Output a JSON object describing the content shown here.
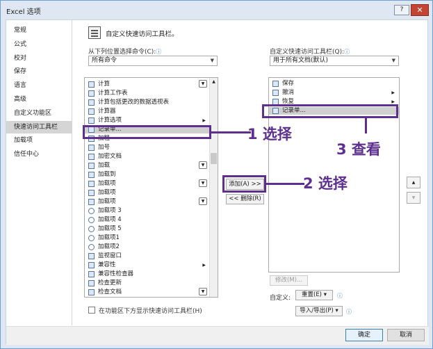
{
  "window": {
    "title": "Excel 选项",
    "help": "?",
    "close": "✕"
  },
  "nav": [
    "常规",
    "公式",
    "校对",
    "保存",
    "语言",
    "高级",
    "自定义功能区",
    "快速访问工具栏",
    "加载项",
    "信任中心"
  ],
  "nav_selected": 7,
  "header": {
    "title": "自定义快速访问工具栏。"
  },
  "left": {
    "from_label": "从下列位置选择命令(C):",
    "from_value": "所有命令",
    "commands": [
      {
        "t": "计算",
        "dd": true
      },
      {
        "t": "计算工作表"
      },
      {
        "t": "计算包括更改的数据透视表"
      },
      {
        "t": "计算器"
      },
      {
        "t": "计算选项",
        "sub": true
      },
      {
        "t": "记录单...",
        "sel": true
      },
      {
        "t": "加粗"
      },
      {
        "t": "加号"
      },
      {
        "t": "加密文档"
      },
      {
        "t": "加载",
        "dd": true
      },
      {
        "t": "加载到"
      },
      {
        "t": "加载项",
        "dd": true
      },
      {
        "t": "加载项"
      },
      {
        "t": "加载项",
        "dd": true
      },
      {
        "t": "加载项 3"
      },
      {
        "t": "加载项 4"
      },
      {
        "t": "加载项 5"
      },
      {
        "t": "加载项1"
      },
      {
        "t": "加载项2"
      },
      {
        "t": "监视窗口"
      },
      {
        "t": "兼容性",
        "sub": true
      },
      {
        "t": "兼容性检查器"
      },
      {
        "t": "检查更新"
      },
      {
        "t": "检查文档",
        "dd": true
      }
    ],
    "show_below_label": "在功能区下方显示快速访问工具栏(H)"
  },
  "middle": {
    "add": "添加(A) >>",
    "remove": "<< 删除(R)"
  },
  "right": {
    "qat_label": "自定义快速访问工具栏(Q):",
    "qat_value": "用于所有文档(默认)",
    "items": [
      {
        "t": "保存"
      },
      {
        "t": "撤消",
        "sub": true
      },
      {
        "t": "恢复",
        "sub": true
      },
      {
        "t": "记录单...",
        "sel": true
      }
    ],
    "modify": "修改(M)...",
    "customize_label": "自定义:",
    "reset": "重置(E) ▾",
    "import_export": "导入/导出(P) ▾",
    "up": "▲",
    "down": "▼"
  },
  "annotations": {
    "a1": "1 选择",
    "a2": "2 选择",
    "a3": "3 查看"
  },
  "footer": {
    "ok": "确定",
    "cancel": "取消"
  },
  "colors": {
    "accent": "#5e2f8f",
    "title_bg": "#dfe8f2",
    "selection": "#cfcfcf"
  }
}
